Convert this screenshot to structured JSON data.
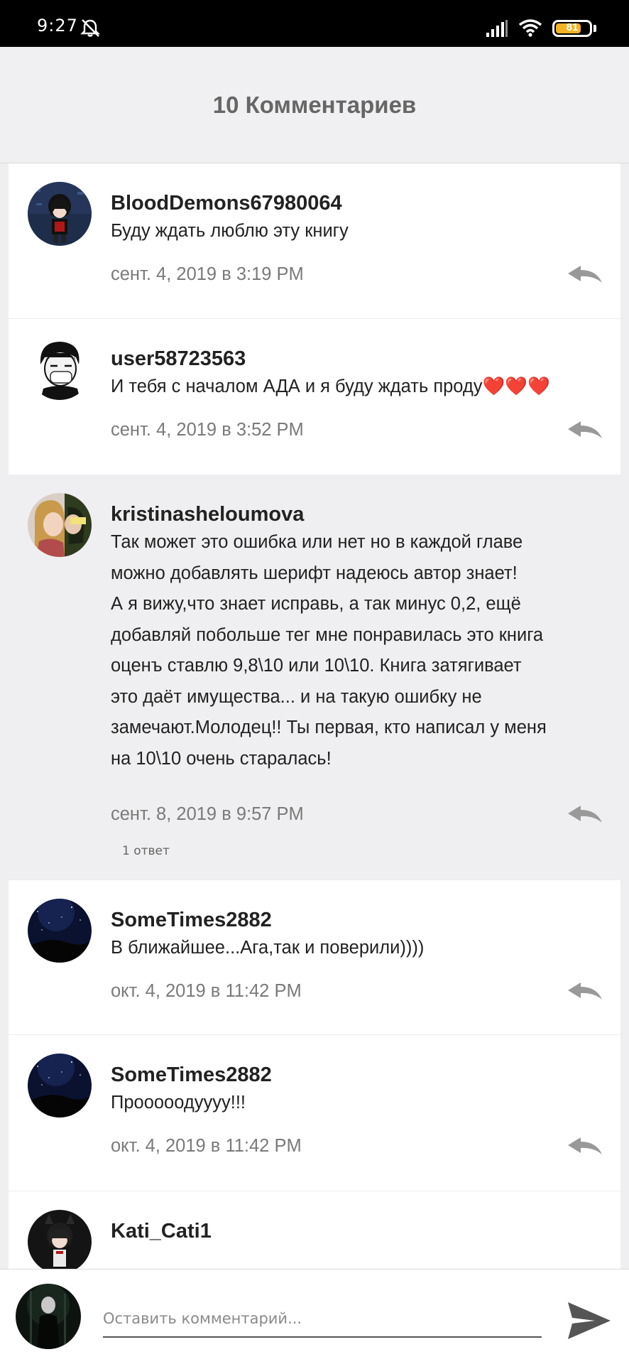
{
  "status_bar": {
    "time": "9:27",
    "battery_level": "81",
    "icons": [
      "alarm-off-icon",
      "signal-icon",
      "wifi-icon",
      "battery-icon"
    ]
  },
  "header": {
    "title": "10 Комментариев"
  },
  "comments": [
    {
      "username": "BloodDemons67980064",
      "text": "Буду ждать люблю эту книгу",
      "date": "сент. 4, 2019 в 3:19 PM"
    },
    {
      "username": "user58723563",
      "text": "И тебя с началом АДА и я буду ждать проду❤️❤️❤️",
      "date": "сент. 4, 2019 в 3:52 PM"
    },
    {
      "username": "kristinasheloumova",
      "text": "Так может это ошибка или нет но в каждой главе\nможно добавлять шерифт надеюсь автор знает!\nА я вижу,что знает исправь, а так минус 0,2, ещё\nдобавляй побольше тег мне понравилась это книга\nоценъ ставлю 9,8\\10 или 10\\10. Книга затягивает\nэто даёт имущества... и на такую ошибку не\nзамечают.Молодец!! Ты первая, кто написал у меня\nна 10\\10 очень старалась!",
      "date": "сент. 8, 2019 в 9:57 PM",
      "replies_label": "1 ответ"
    },
    {
      "username": "SomeTimes2882",
      "text": "В ближайшее...Ага,так и поверили))))",
      "date": "окт. 4, 2019 в 11:42 PM"
    },
    {
      "username": "SomeTimes2882",
      "text": "Прооооодуууу!!!",
      "date": "окт. 4, 2019 в 11:42 PM"
    },
    {
      "username": "Kati_Cati1"
    }
  ],
  "composer": {
    "placeholder": "Оставить комментарий..."
  },
  "colors": {
    "accent_grey": "#666666",
    "date_grey": "#7a7a7a",
    "battery": "#f4b324"
  }
}
